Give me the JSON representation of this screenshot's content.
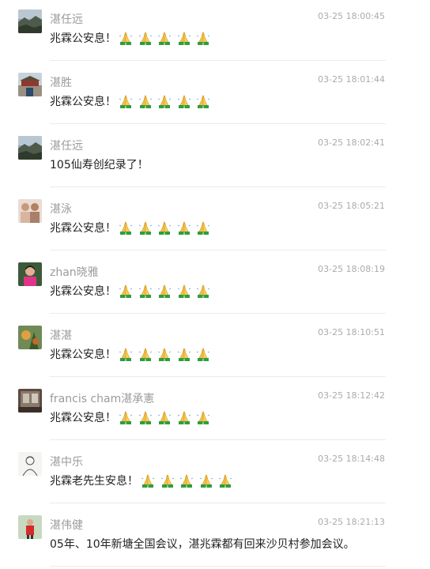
{
  "comments": [
    {
      "name": "湛任远",
      "time": "03-25 18:00:45",
      "text": "兆霖公安息！",
      "emojis": [
        "folded-hands-icon",
        "folded-hands-icon",
        "folded-hands-icon",
        "folded-hands-icon",
        "folded-hands-icon"
      ],
      "avatar": "landscape-avatar"
    },
    {
      "name": "湛胜",
      "time": "03-25 18:01:44",
      "text": "兆霖公安息！",
      "emojis": [
        "folded-hands-icon",
        "folded-hands-icon",
        "folded-hands-icon",
        "folded-hands-icon",
        "folded-hands-icon"
      ],
      "avatar": "palace-avatar"
    },
    {
      "name": "湛任远",
      "time": "03-25 18:02:41",
      "text": "105仙寿创纪录了！",
      "emojis": [],
      "avatar": "landscape-avatar"
    },
    {
      "name": "湛泳",
      "time": "03-25 18:05:21",
      "text": "兆霖公安息！",
      "emojis": [
        "folded-hands-icon",
        "folded-hands-icon",
        "folded-hands-icon",
        "folded-hands-icon",
        "folded-hands-icon"
      ],
      "avatar": "people-avatar"
    },
    {
      "name": "zhan晓雅",
      "time": "03-25 18:08:19",
      "text": "兆霖公安息！",
      "emojis": [
        "folded-hands-icon",
        "folded-hands-icon",
        "folded-hands-icon",
        "folded-hands-icon",
        "folded-hands-icon"
      ],
      "avatar": "woman-avatar"
    },
    {
      "name": "湛湛",
      "time": "03-25 18:10:51",
      "text": "兆霖公安息！",
      "emojis": [
        "folded-hands-icon",
        "folded-hands-icon",
        "folded-hands-icon",
        "folded-hands-icon",
        "folded-hands-icon"
      ],
      "avatar": "painting-avatar"
    },
    {
      "name": "francis cham湛承憲",
      "time": "03-25 18:12:42",
      "text": "兆霖公安息！",
      "emojis": [
        "folded-hands-icon",
        "folded-hands-icon",
        "folded-hands-icon",
        "folded-hands-icon",
        "folded-hands-icon"
      ],
      "avatar": "room-avatar"
    },
    {
      "name": "湛中乐",
      "time": "03-25 18:14:48",
      "text": "兆霖老先生安息！",
      "emojis": [
        "folded-hands-icon",
        "folded-hands-icon",
        "folded-hands-icon",
        "folded-hands-icon",
        "folded-hands-icon"
      ],
      "avatar": "sketch-avatar"
    },
    {
      "name": "湛伟健",
      "time": "03-25 18:21:13",
      "text": "05年、10年新塘全国会议，湛兆霖都有回来沙贝村参加会议。",
      "emojis": [],
      "avatar": "red-person-avatar"
    }
  ],
  "colors": {
    "name": "#9b9b9b",
    "time": "#ababab",
    "text": "#222222",
    "divider": "#ebebeb"
  }
}
